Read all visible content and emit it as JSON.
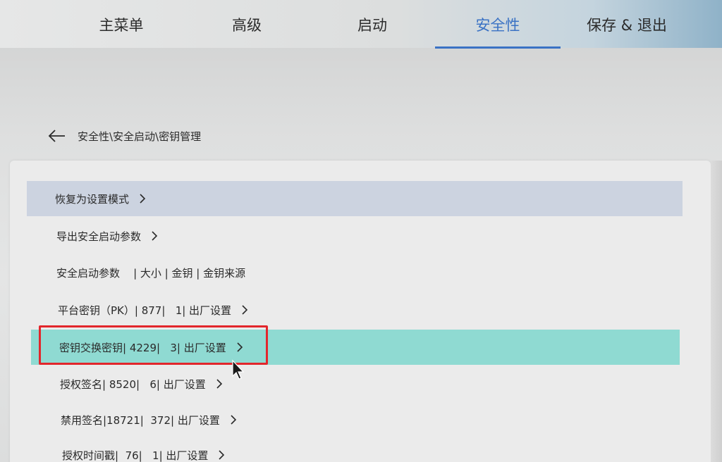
{
  "tabs": [
    {
      "label": "主菜单"
    },
    {
      "label": "高级"
    },
    {
      "label": "启动"
    },
    {
      "label": "安全性"
    },
    {
      "label": "保存 & 退出"
    }
  ],
  "active_tab": "安全性",
  "breadcrumb": {
    "text": "安全性\\安全启动\\密钥管理"
  },
  "rows": [
    {
      "label": "恢复为设置模式",
      "has_chevron": true
    },
    {
      "label": "导出安全启动参数",
      "has_chevron": true
    },
    {
      "label": "安全启动参数    | 大小 | 金钥 | 金钥来源",
      "has_chevron": false
    },
    {
      "label": "平台密钥（PK）| 877|   1| 出厂设置",
      "has_chevron": true
    },
    {
      "label": "密钥交换密钥| 4229|   3| 出厂设置",
      "has_chevron": true
    },
    {
      "label": "授权签名| 8520|   6| 出厂设置",
      "has_chevron": true
    },
    {
      "label": "禁用签名|18721|  372| 出厂设置",
      "has_chevron": true
    },
    {
      "label": "授权时间戳|  76|   1| 出厂设置",
      "has_chevron": true
    }
  ],
  "colors": {
    "accent": "#3a72c4",
    "row_hover_gray": "#ccd3e0",
    "row_selected_teal": "#8fdad2",
    "annotation_red": "#e2262c"
  }
}
